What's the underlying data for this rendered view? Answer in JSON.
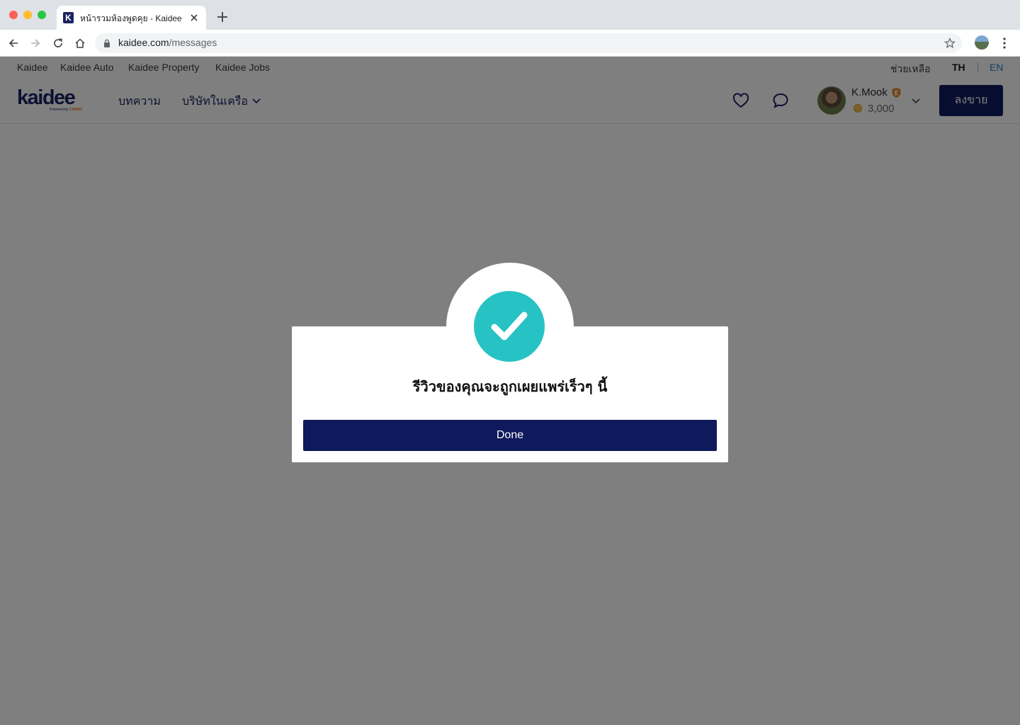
{
  "browser": {
    "tab_title": "หน้ารวมห้องพูดคุย - Kaidee",
    "favicon_letter": "K",
    "url_host": "kaidee.com",
    "url_path": "/messages"
  },
  "topnav": {
    "links": [
      "Kaidee",
      "Kaidee Auto",
      "Kaidee Property",
      "Kaidee Jobs"
    ],
    "help": "ช่วยเหลือ",
    "lang_th": "TH",
    "lang_en": "EN"
  },
  "header": {
    "logo": "kaidee",
    "logo_sub_prefix": "Powered by ",
    "logo_sub_brand": "CARRO",
    "articles": "บทความ",
    "network": "บริษัทในเครือ",
    "user_name": "K.Mook",
    "coins": "3,000",
    "sell": "ลงขาย"
  },
  "modal": {
    "message": "รีวิวของคุณจะถูกเผยแพร่เร็วๆ นี้",
    "done": "Done"
  },
  "colors": {
    "brand_navy": "#0f1a5c",
    "success_teal": "#27c2c4",
    "lang_active": "#1a1a1a",
    "lang_inactive": "#2a7fd4"
  },
  "icons": [
    "heart-icon",
    "chat-icon",
    "check-icon",
    "chevron-down-icon",
    "lock-icon",
    "star-icon"
  ]
}
